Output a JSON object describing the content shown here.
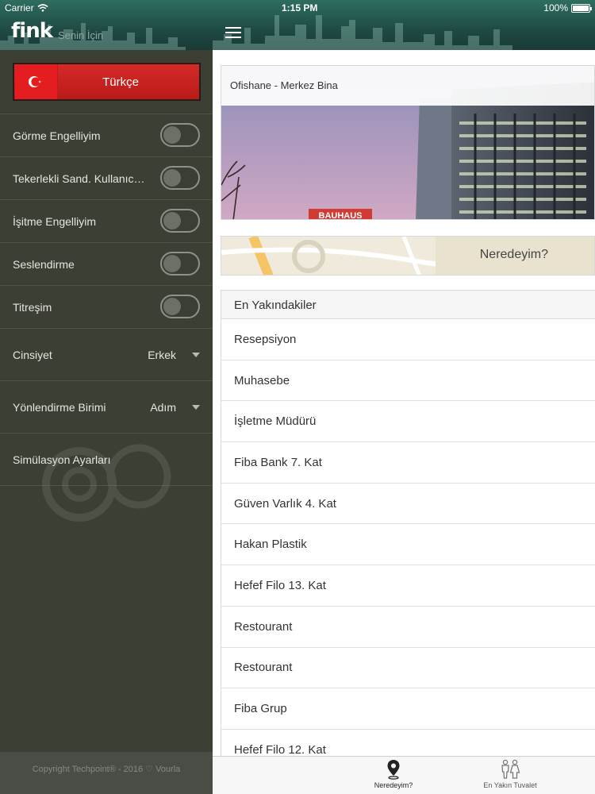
{
  "status_bar": {
    "carrier": "Carrier",
    "time": "1:15 PM",
    "battery": "100%"
  },
  "sidebar": {
    "logo": "fink",
    "subtitle": "Senin İçin",
    "language_button": "Türkçe",
    "toggles": [
      {
        "label": "Görme Engelliyim",
        "on": false
      },
      {
        "label": "Tekerlekli Sand. Kullanıcısıyım",
        "on": false
      },
      {
        "label": "İşitme Engelliyim",
        "on": false
      },
      {
        "label": "Seslendirme",
        "on": false
      },
      {
        "label": "Titreşim",
        "on": false
      }
    ],
    "gender": {
      "label": "Cinsiyet",
      "value": "Erkek"
    },
    "direction_unit": {
      "label": "Yönlendirme Birimi",
      "value": "Adım"
    },
    "simulation": "Simülasyon Ayarları",
    "footer": "Copyright Techpoint® - 2016 ♡ Vourla"
  },
  "main": {
    "building_title": "Ofishane - Merkez Bina",
    "building_sign": "BAUHAUS",
    "map_label": "Neredeyim?",
    "nearest_header": "En Yakındakiler",
    "nearest": [
      "Resepsiyon",
      "Muhasebe",
      "İşletme Müdürü",
      "Fiba Bank 7. Kat",
      "Güven Varlık 4. Kat",
      "Hakan Plastik",
      "Hefef Filo 13. Kat",
      "Restourant",
      "Restourant",
      "Fiba Grup",
      "Hefef Filo 12. Kat"
    ]
  },
  "tabbar": {
    "tabs": [
      {
        "label": "Neredeyim?",
        "icon": "location-pin-icon",
        "active": true
      },
      {
        "label": "En Yakın Tuvalet",
        "icon": "restroom-icon",
        "active": false
      }
    ]
  },
  "colors": {
    "header": "#1f4a44",
    "sidebar": "#3c4034",
    "language_button": "#c62220"
  }
}
